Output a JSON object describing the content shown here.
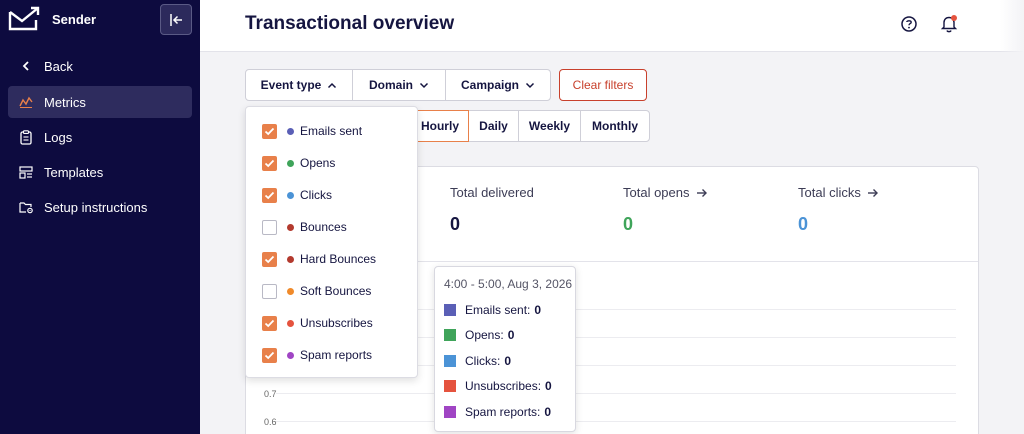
{
  "brand": {
    "name": "Sender"
  },
  "sidebar": {
    "items": [
      {
        "label": "Back",
        "icon": "chevron-left-icon"
      },
      {
        "label": "Metrics",
        "icon": "metrics-icon",
        "active": true
      },
      {
        "label": "Logs",
        "icon": "clipboard-icon"
      },
      {
        "label": "Templates",
        "icon": "templates-icon"
      },
      {
        "label": "Setup instructions",
        "icon": "folder-settings-icon"
      }
    ]
  },
  "header": {
    "title": "Transactional overview"
  },
  "filters": {
    "event_type": "Event type",
    "domain": "Domain",
    "campaign": "Campaign",
    "clear": "Clear filters"
  },
  "granularity": {
    "hourly": "Hourly",
    "daily": "Daily",
    "weekly": "Weekly",
    "monthly": "Monthly",
    "selected": "Hourly"
  },
  "event_options": [
    {
      "label": "Emails sent",
      "checked": true,
      "color": "#5a5fb6"
    },
    {
      "label": "Opens",
      "checked": true,
      "color": "#3fa45a"
    },
    {
      "label": "Clicks",
      "checked": true,
      "color": "#4b93d6"
    },
    {
      "label": "Bounces",
      "checked": false,
      "color": "#b33a2e"
    },
    {
      "label": "Hard Bounces",
      "checked": true,
      "color": "#b33a2e"
    },
    {
      "label": "Soft Bounces",
      "checked": false,
      "color": "#f08a2a"
    },
    {
      "label": "Unsubscribes",
      "checked": true,
      "color": "#e5533e"
    },
    {
      "label": "Spam reports",
      "checked": true,
      "color": "#a045c4"
    }
  ],
  "stats": {
    "delivered": {
      "label": "Total delivered",
      "value": "0",
      "color": "#151540"
    },
    "opens": {
      "label": "Total opens",
      "value": "0",
      "color": "#3fa45a"
    },
    "clicks": {
      "label": "Total clicks",
      "value": "0",
      "color": "#4b93d6"
    }
  },
  "chart": {
    "y_ticks": [
      "0.7",
      "0.6"
    ]
  },
  "tooltip": {
    "title": "4:00 - 5:00, Aug 3, 2026",
    "rows": [
      {
        "label": "Emails sent:",
        "value": "0",
        "color": "#5a5fb6"
      },
      {
        "label": "Opens:",
        "value": "0",
        "color": "#3fa45a"
      },
      {
        "label": "Clicks:",
        "value": "0",
        "color": "#4b93d6"
      },
      {
        "label": "Unsubscribes:",
        "value": "0",
        "color": "#e5533e"
      },
      {
        "label": "Spam reports:",
        "value": "0",
        "color": "#a045c4"
      }
    ]
  }
}
